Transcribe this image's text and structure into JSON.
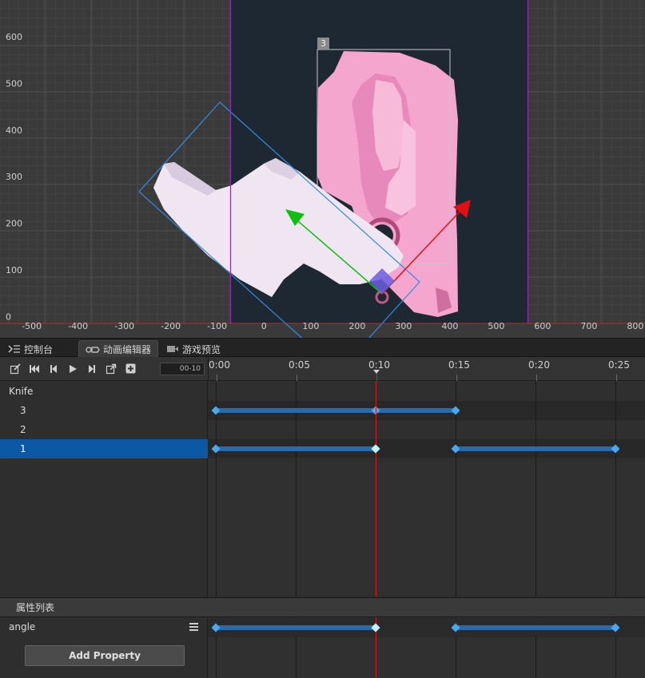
{
  "scene": {
    "x_axis_labels": [
      "-500",
      "-400",
      "-300",
      "-200",
      "-100",
      "0",
      "100",
      "200",
      "300",
      "400",
      "500",
      "600",
      "700",
      "800"
    ],
    "y_axis_labels": [
      "600",
      "500",
      "400",
      "300",
      "200",
      "100",
      "0"
    ],
    "selection_badge": "3",
    "colors": {
      "grid_bg": "#3a3a3a",
      "canvas_bg": "#1e2833",
      "canvas_border": "#8c2bb0",
      "x_axis": "#b03030",
      "gizmo_x": "#e01010",
      "gizmo_y": "#10c010",
      "gizmo_center": "#6a5de0",
      "selection": "#2f8de0"
    },
    "sprites": [
      "pink-knife-handle",
      "white-knife-blade"
    ]
  },
  "tabs": [
    {
      "label": "控制台",
      "icon": "console-icon",
      "active": false
    },
    {
      "label": "动画编辑器",
      "icon": "animation-icon",
      "active": true
    },
    {
      "label": "游戏预览",
      "icon": "camera-icon",
      "active": false
    }
  ],
  "toolbar": {
    "buttons": [
      "edit-icon",
      "jump-start-icon",
      "previous-frame-icon",
      "play-icon",
      "next-frame-icon",
      "export-icon",
      "add-icon"
    ],
    "time_value": "00-10"
  },
  "ruler": {
    "labels": [
      "0:00",
      "0:05",
      "0:10",
      "0:15",
      "0:20",
      "0:25"
    ],
    "current_time": "0:10"
  },
  "nodes": [
    {
      "label": "Knife",
      "indent": false,
      "selected": false
    },
    {
      "label": "3",
      "indent": true,
      "selected": false
    },
    {
      "label": "2",
      "indent": true,
      "selected": false
    },
    {
      "label": "1",
      "indent": true,
      "selected": true
    }
  ],
  "tracks": [
    {
      "node": "Knife",
      "keyframes": [],
      "segments": []
    },
    {
      "node": "3",
      "keyframes": [
        0,
        10,
        15
      ],
      "segments": [
        [
          0,
          15
        ]
      ]
    },
    {
      "node": "2",
      "keyframes": [],
      "segments": []
    },
    {
      "node": "1",
      "keyframes": [
        0,
        10,
        15,
        25
      ],
      "segments": [
        [
          0,
          10
        ],
        [
          15,
          25
        ]
      ],
      "highlight": 10
    }
  ],
  "properties": {
    "header": "属性列表",
    "items": [
      {
        "label": "angle",
        "keyframes": [
          0,
          10,
          15,
          25
        ],
        "segments": [
          [
            0,
            10
          ],
          [
            15,
            25
          ]
        ],
        "highlight": 10
      }
    ],
    "add_button": "Add Property"
  },
  "timeline_colors": {
    "keyframe": "#4aa8f0",
    "keyframe_active": "#bff3ff",
    "segment": "#2a6aa8",
    "playhead": "#d02020"
  }
}
